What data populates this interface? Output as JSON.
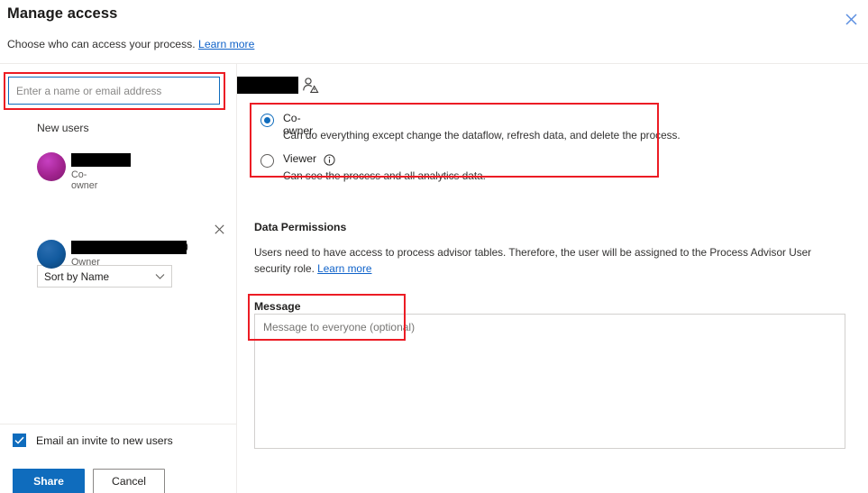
{
  "header": {
    "title": "Manage access",
    "subtitle": "Choose who can access your process.",
    "learn_more": "Learn more",
    "close_icon": "close-icon"
  },
  "left_panel": {
    "picker": {
      "placeholder": "Enter a name or email address",
      "value": "",
      "focus_color": "#0f6cbd"
    },
    "new_users_label": "New users",
    "new_users": [
      {
        "name_redacted": true,
        "role": "Co-owner",
        "avatar_color": "#a2238f",
        "remove_icon": "close-icon"
      }
    ],
    "sort": {
      "selected": "Sort by Name",
      "chevron_icon": "chevron-down-icon"
    },
    "existing_users": [
      {
        "name_redacted": true,
        "name_suffix": ")",
        "role": "Owner",
        "avatar_color": "#125a9e"
      }
    ],
    "email_invite": {
      "label": "Email an invite to new users",
      "checked": true,
      "check_icon": "check-icon"
    },
    "buttons": {
      "share": "Share",
      "cancel": "Cancel"
    }
  },
  "right_panel": {
    "target": {
      "name_redacted": true,
      "icon": "person-warning-icon"
    },
    "roles": [
      {
        "label": "Co-owner",
        "description": "Can do everything except change the dataflow, refresh data, and delete the process.",
        "selected": true
      },
      {
        "label": "Viewer",
        "description": "Can see the process and all analytics data.",
        "selected": false,
        "info_icon": "info-icon"
      }
    ],
    "data_permissions": {
      "title": "Data Permissions",
      "body": "Users need to have access to process advisor tables. Therefore, the user will be assigned to the Process Advisor User security role.",
      "learn_more": "Learn more"
    },
    "message": {
      "label": "Message",
      "placeholder": "Message to everyone (optional)",
      "value": ""
    }
  },
  "annotations": {
    "highlight_color": "#ec1c24",
    "boxes": [
      "picker-input",
      "role-radio-group",
      "message-field"
    ]
  }
}
